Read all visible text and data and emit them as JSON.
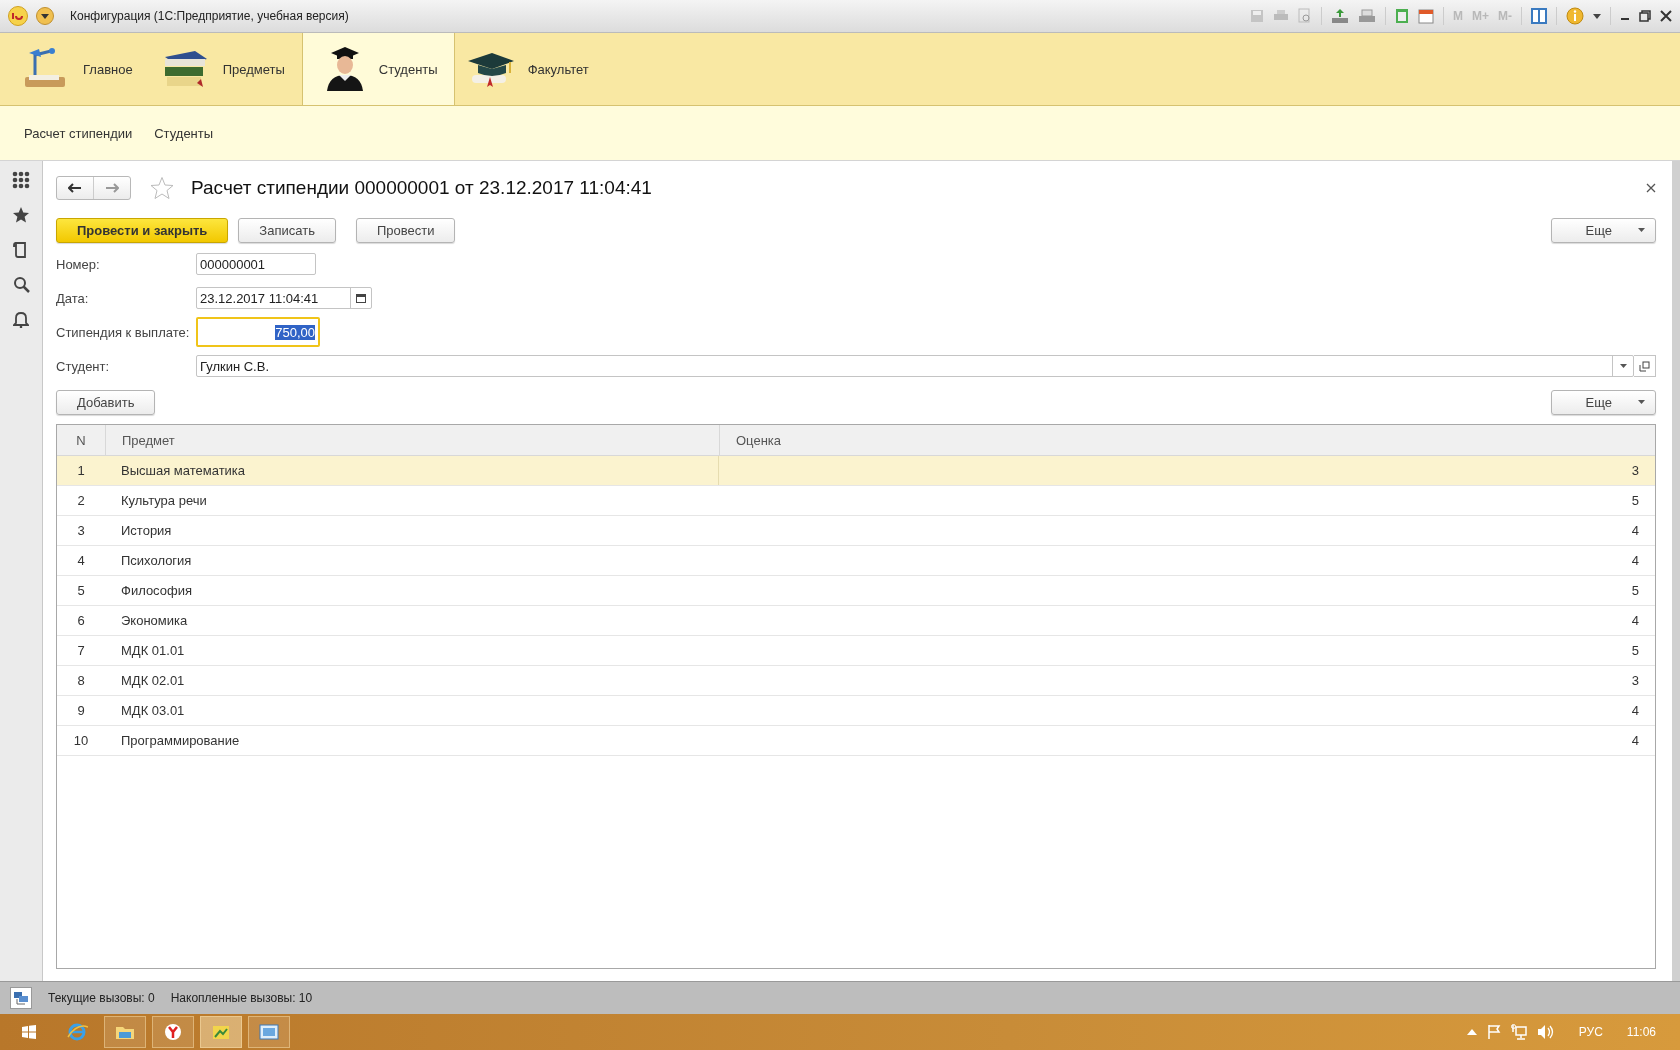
{
  "window": {
    "title": "Конфигурация  (1С:Предприятие, учебная версия)",
    "memory_buttons": [
      "M",
      "M+",
      "M-"
    ]
  },
  "sections": [
    {
      "label": "Главное",
      "selected": false
    },
    {
      "label": "Предметы",
      "selected": false
    },
    {
      "label": "Студенты",
      "selected": true
    },
    {
      "label": "Факультет",
      "selected": false
    }
  ],
  "subsections": [
    "Расчет стипендии",
    "Студенты"
  ],
  "form": {
    "title": "Расчет стипендии 000000001 от 23.12.2017 11:04:41",
    "buttons": [
      {
        "label": "Провести и закрыть",
        "kind": "primary"
      },
      {
        "label": "Записать",
        "kind": "normal"
      },
      {
        "label": "Провести",
        "kind": "normal"
      }
    ],
    "more": "Еще",
    "fields": [
      {
        "label": "Номер:",
        "value": "000000001",
        "kind": "text",
        "focused": false
      },
      {
        "label": "Дата:",
        "value": "23.12.2017 11:04:41",
        "kind": "date",
        "focused": false
      },
      {
        "label": "Стипендия к выплате:",
        "value": "750,00",
        "kind": "number",
        "focused": true
      },
      {
        "label": "Студент:",
        "value": "Гулкин С.В.",
        "kind": "select",
        "focused": false
      }
    ],
    "table": {
      "add": "Добавить",
      "more": "Еще",
      "columns": [
        "N",
        "Предмет",
        "Оценка"
      ],
      "rows": [
        {
          "n": "1",
          "subject": "Высшая математика",
          "grade": "3",
          "selected": true
        },
        {
          "n": "2",
          "subject": "Культура речи",
          "grade": "5",
          "selected": false
        },
        {
          "n": "3",
          "subject": "История",
          "grade": "4",
          "selected": false
        },
        {
          "n": "4",
          "subject": "Психология",
          "grade": "4",
          "selected": false
        },
        {
          "n": "5",
          "subject": "Философия",
          "grade": "5",
          "selected": false
        },
        {
          "n": "6",
          "subject": "Экономика",
          "grade": "4",
          "selected": false
        },
        {
          "n": "7",
          "subject": "МДК 01.01",
          "grade": "5",
          "selected": false
        },
        {
          "n": "8",
          "subject": "МДК 02.01",
          "grade": "3",
          "selected": false
        },
        {
          "n": "9",
          "subject": "МДК 03.01",
          "grade": "4",
          "selected": false
        },
        {
          "n": "10",
          "subject": "Программирование",
          "grade": "4",
          "selected": false
        }
      ]
    }
  },
  "status_bar": {
    "current": "Текущие вызовы: 0",
    "accumulated": "Накопленные вызовы: 10"
  },
  "taskbar": {
    "language": "РУС",
    "clock": "11:06"
  }
}
